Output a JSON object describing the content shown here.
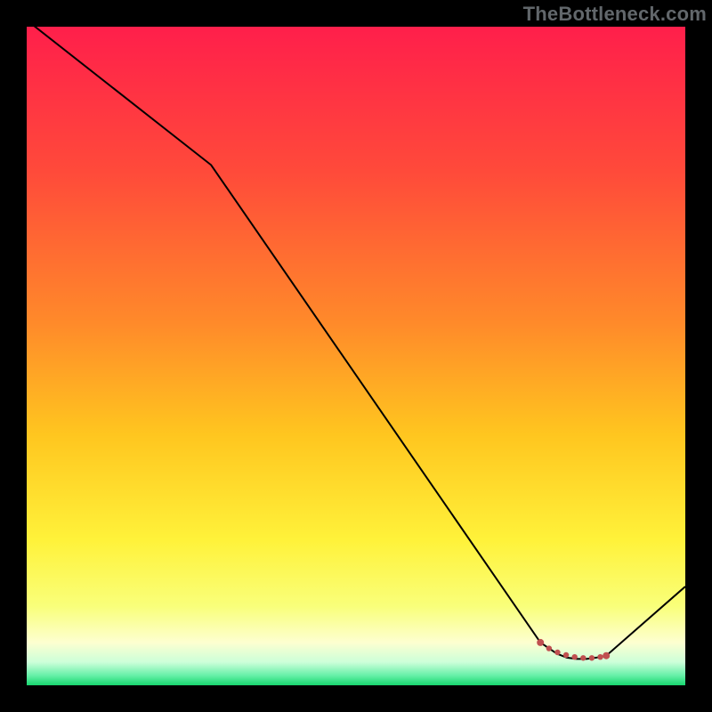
{
  "watermark": "TheBottleneck.com",
  "chart_data": {
    "type": "line",
    "title": "",
    "xlabel": "",
    "ylabel": "",
    "xlim": [
      0,
      100
    ],
    "ylim": [
      0,
      100
    ],
    "gradient_stops": [
      {
        "offset": 0.0,
        "color": "#ff1f4b"
      },
      {
        "offset": 0.22,
        "color": "#ff4a3a"
      },
      {
        "offset": 0.45,
        "color": "#ff8a2a"
      },
      {
        "offset": 0.62,
        "color": "#ffc61f"
      },
      {
        "offset": 0.78,
        "color": "#fff23a"
      },
      {
        "offset": 0.88,
        "color": "#f9ff7a"
      },
      {
        "offset": 0.935,
        "color": "#fdffd0"
      },
      {
        "offset": 0.965,
        "color": "#ccffd9"
      },
      {
        "offset": 0.985,
        "color": "#66f0a8"
      },
      {
        "offset": 1.0,
        "color": "#17d66f"
      }
    ],
    "series": [
      {
        "name": "bottleneck-curve",
        "color": "#000000",
        "width": 2,
        "x": [
          0,
          28,
          78,
          80.5,
          82,
          83.5,
          85,
          86.5,
          88,
          100
        ],
        "y": [
          101,
          79,
          6.5,
          4.8,
          4.2,
          4.0,
          4.0,
          4.2,
          4.5,
          15
        ]
      }
    ],
    "markers": {
      "name": "optimal-range",
      "color": "#c05050",
      "radius_small": 3.2,
      "radius_end": 4.0,
      "x": [
        78,
        79.3,
        80.6,
        81.9,
        83.2,
        84.5,
        85.8,
        87.1,
        88
      ],
      "y": [
        6.5,
        5.6,
        5.0,
        4.6,
        4.3,
        4.15,
        4.15,
        4.3,
        4.5
      ]
    }
  }
}
